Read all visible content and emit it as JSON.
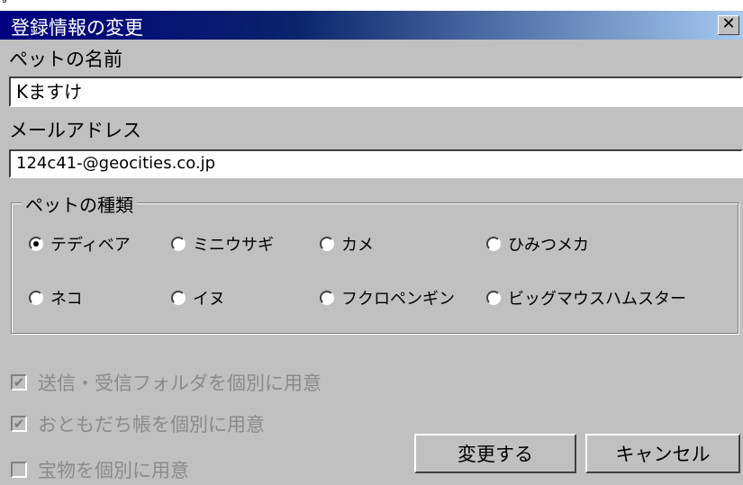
{
  "above_text": "登録情報の変更",
  "window": {
    "title": "登録情報の変更",
    "close_glyph": "✕"
  },
  "pet_name": {
    "label": "ペットの名前",
    "value": "Kますけ"
  },
  "email": {
    "label": "メールアドレス",
    "value": "124c41-@geocities.co.jp"
  },
  "pet_type": {
    "legend": "ペットの種類",
    "options": [
      {
        "label": "テディベア",
        "selected": true
      },
      {
        "label": "ミニウサギ",
        "selected": false
      },
      {
        "label": "カメ",
        "selected": false
      },
      {
        "label": "ひみつメカ",
        "selected": false
      },
      {
        "label": "ネコ",
        "selected": false
      },
      {
        "label": "イヌ",
        "selected": false
      },
      {
        "label": "フクロペンギン",
        "selected": false
      },
      {
        "label": "ビッグマウスハムスター",
        "selected": false
      }
    ]
  },
  "options": [
    {
      "label": "送信・受信フォルダを個別に用意",
      "checked": true,
      "disabled": true
    },
    {
      "label": "おともだち帳を個別に用意",
      "checked": true,
      "disabled": true
    },
    {
      "label": "宝物を個別に用意",
      "checked": false,
      "disabled": true
    }
  ],
  "buttons": {
    "change": "変更する",
    "cancel": "キャンセル"
  }
}
